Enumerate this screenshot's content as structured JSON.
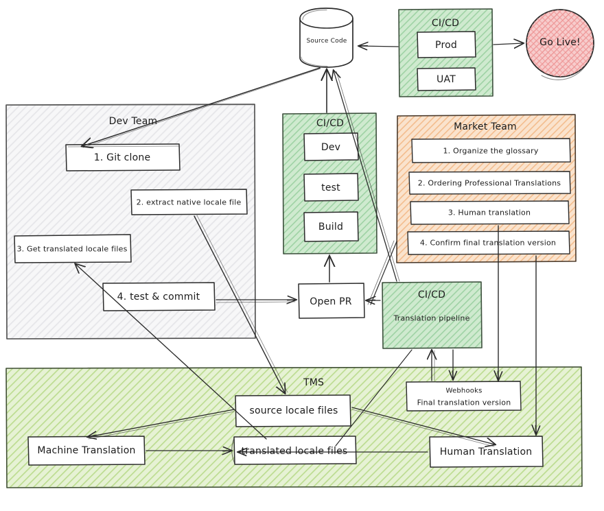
{
  "diagram": {
    "title": "Localization / Translation CI-CD Workflow",
    "style": "hand-drawn sketch",
    "colors": {
      "green_fill": "#b9dfc0",
      "green_fill_light": "#d3e9b5",
      "orange_fill": "#f6cfab",
      "grey_fill": "#f0f0f1",
      "red_fill": "#f3a6a6",
      "stroke": "#2b2b2b",
      "stroke_soft": "#555555"
    }
  },
  "nodes": {
    "source_code": {
      "label": "Source Code",
      "shape": "cylinder"
    },
    "cicd_prod": {
      "title": "CI/CD",
      "items": [
        "Prod",
        "UAT"
      ]
    },
    "go_live": {
      "label": "Go Live!",
      "shape": "circle"
    },
    "dev_team": {
      "title": "Dev Team",
      "items": [
        "1. Git clone",
        "2. extract native locale file",
        "3. Get translated locale files",
        "4. test & commit"
      ]
    },
    "cicd_dev": {
      "title": "CI/CD",
      "items": [
        "Dev",
        "test",
        "Build"
      ]
    },
    "market_team": {
      "title": "Market Team",
      "items": [
        "1. Organize the glossary",
        "2. Ordering Professional Translations",
        "3. Human translation",
        "4. Confirm final translation version"
      ]
    },
    "open_pr": {
      "label": "Open PR"
    },
    "cicd_translation": {
      "title": "CI/CD",
      "subtitle": "Translation pipeline"
    },
    "tms": {
      "title": "TMS",
      "items": [
        "source locale files",
        "translated locale files",
        "Machine Translation",
        "Human Translation"
      ]
    },
    "webhooks": {
      "line1": "Webhooks",
      "line2": "Final translation version"
    }
  }
}
